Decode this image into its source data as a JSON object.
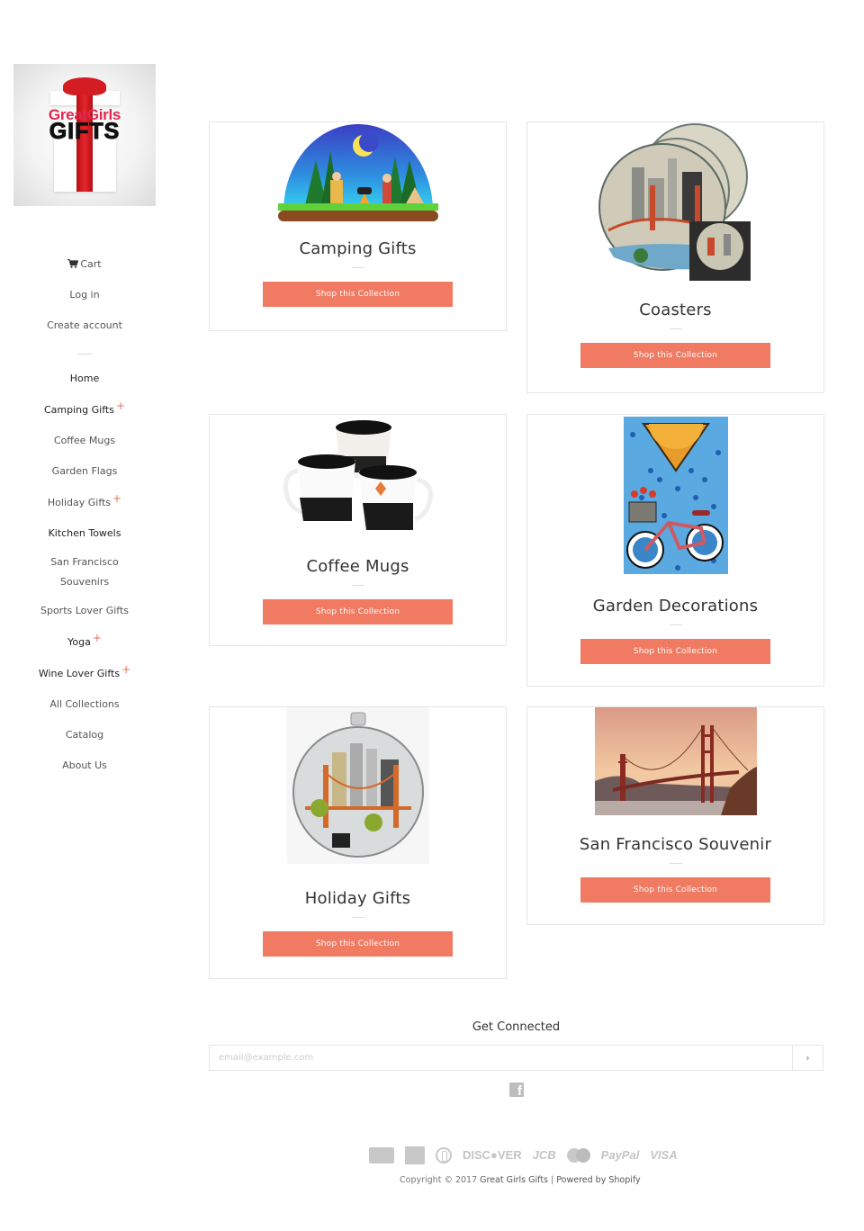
{
  "logo": {
    "line1": "GreatGirls",
    "line2": "GIFTS",
    "alt": "Great Girls Gifts"
  },
  "account": {
    "cart": "Cart",
    "login": "Log in",
    "create": "Create account"
  },
  "nav": [
    {
      "label": "Home",
      "expandable": false
    },
    {
      "label": "Camping Gifts",
      "expandable": true
    },
    {
      "label": "Coffee Mugs",
      "expandable": false
    },
    {
      "label": "Garden Flags",
      "expandable": false
    },
    {
      "label": "Holiday Gifts",
      "expandable": true
    },
    {
      "label": "Kitchen Towels",
      "expandable": false
    },
    {
      "label": "San Francisco Souvenirs",
      "expandable": false
    },
    {
      "label": "Sports Lover Gifts",
      "expandable": false
    },
    {
      "label": "Yoga",
      "expandable": true
    },
    {
      "label": "Wine Lover Gifts",
      "expandable": true
    },
    {
      "label": "All Collections",
      "expandable": false
    },
    {
      "label": "Catalog",
      "expandable": false
    },
    {
      "label": "About Us",
      "expandable": false
    }
  ],
  "nav_expand_symbol": "+",
  "collections": [
    {
      "title": "Camping Gifts",
      "button": "Shop this Collection",
      "image": "camping-illustration"
    },
    {
      "title": "Coasters",
      "button": "Shop this Collection",
      "image": "san-francisco-coasters"
    },
    {
      "title": "Coffee Mugs",
      "button": "Shop this Collection",
      "image": "skyline-mugs"
    },
    {
      "title": "Garden Decorations",
      "button": "Shop this Collection",
      "image": "bicycle-garden-flag"
    },
    {
      "title": "Holiday Gifts",
      "button": "Shop this Collection",
      "image": "san-francisco-ornament"
    },
    {
      "title": "San Francisco Souvenir",
      "button": "Shop this Collection",
      "image": "golden-gate-bridge"
    }
  ],
  "newsletter": {
    "heading": "Get Connected",
    "placeholder": "email@example.com",
    "submit": "›"
  },
  "social": {
    "facebook": "f"
  },
  "payments": [
    "amazon_payments",
    "american_express",
    "diners_club",
    "DISC●VER",
    "JCB",
    "master",
    "PayPal",
    "VISA"
  ],
  "footer": {
    "copyright_prefix": "Copyright © 2017 ",
    "store": "Great Girls Gifts",
    "separator": " | ",
    "powered": "Powered by Shopify"
  },
  "colors": {
    "accent": "#f07a62",
    "plus": "#e8725d",
    "border": "#e6e6e6"
  }
}
